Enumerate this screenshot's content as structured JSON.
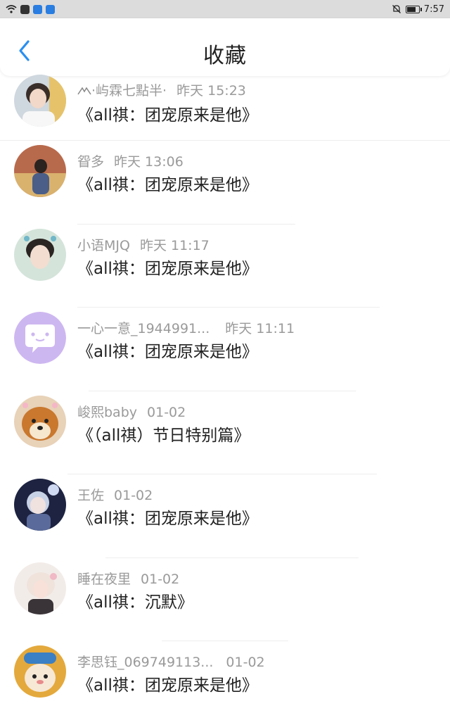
{
  "status_bar": {
    "time": "7:57"
  },
  "header": {
    "title": "收藏"
  },
  "items": [
    {
      "name": "·屿霖七點半·",
      "time": "昨天 15:23",
      "text": "《all祺：团宠原来是他》"
    },
    {
      "name": "眢多",
      "time": "昨天 13:06",
      "text": "《all祺：团宠原来是他》"
    },
    {
      "name": "小语MJQ",
      "time": "昨天 11:17",
      "text": "《all祺：团宠原来是他》"
    },
    {
      "name": "一心一意_1944991...",
      "time": "昨天 11:11",
      "text": "《all祺：团宠原来是他》"
    },
    {
      "name": "峻熙baby",
      "time": "01-02",
      "text": "《（all祺）节日特别篇》"
    },
    {
      "name": "王佐",
      "time": "01-02",
      "text": "《all祺：团宠原来是他》"
    },
    {
      "name": "睡在夜里",
      "time": "01-02",
      "text": "《all祺：沉默》"
    },
    {
      "name": "李思钰_069749113...",
      "time": "01-02",
      "text": "《all祺：团宠原来是他》"
    }
  ]
}
